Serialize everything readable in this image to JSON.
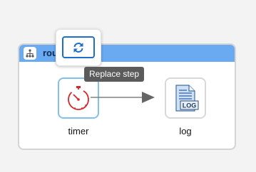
{
  "route": {
    "label": "rou",
    "icon": "route-icon",
    "header_color": "#6aaaf0"
  },
  "toolbar": {
    "replace_icon": "refresh-icon",
    "tooltip": "Replace step"
  },
  "steps": [
    {
      "label": "timer",
      "icon": "timer-icon",
      "selected": true
    },
    {
      "label": "log",
      "icon": "log-icon",
      "selected": false
    }
  ],
  "connector": {
    "icon": "arrow-right-icon"
  },
  "colors": {
    "accent_blue": "#1d6fc9",
    "timer_red": "#d9262c",
    "selection_border": "#84c0ec"
  }
}
